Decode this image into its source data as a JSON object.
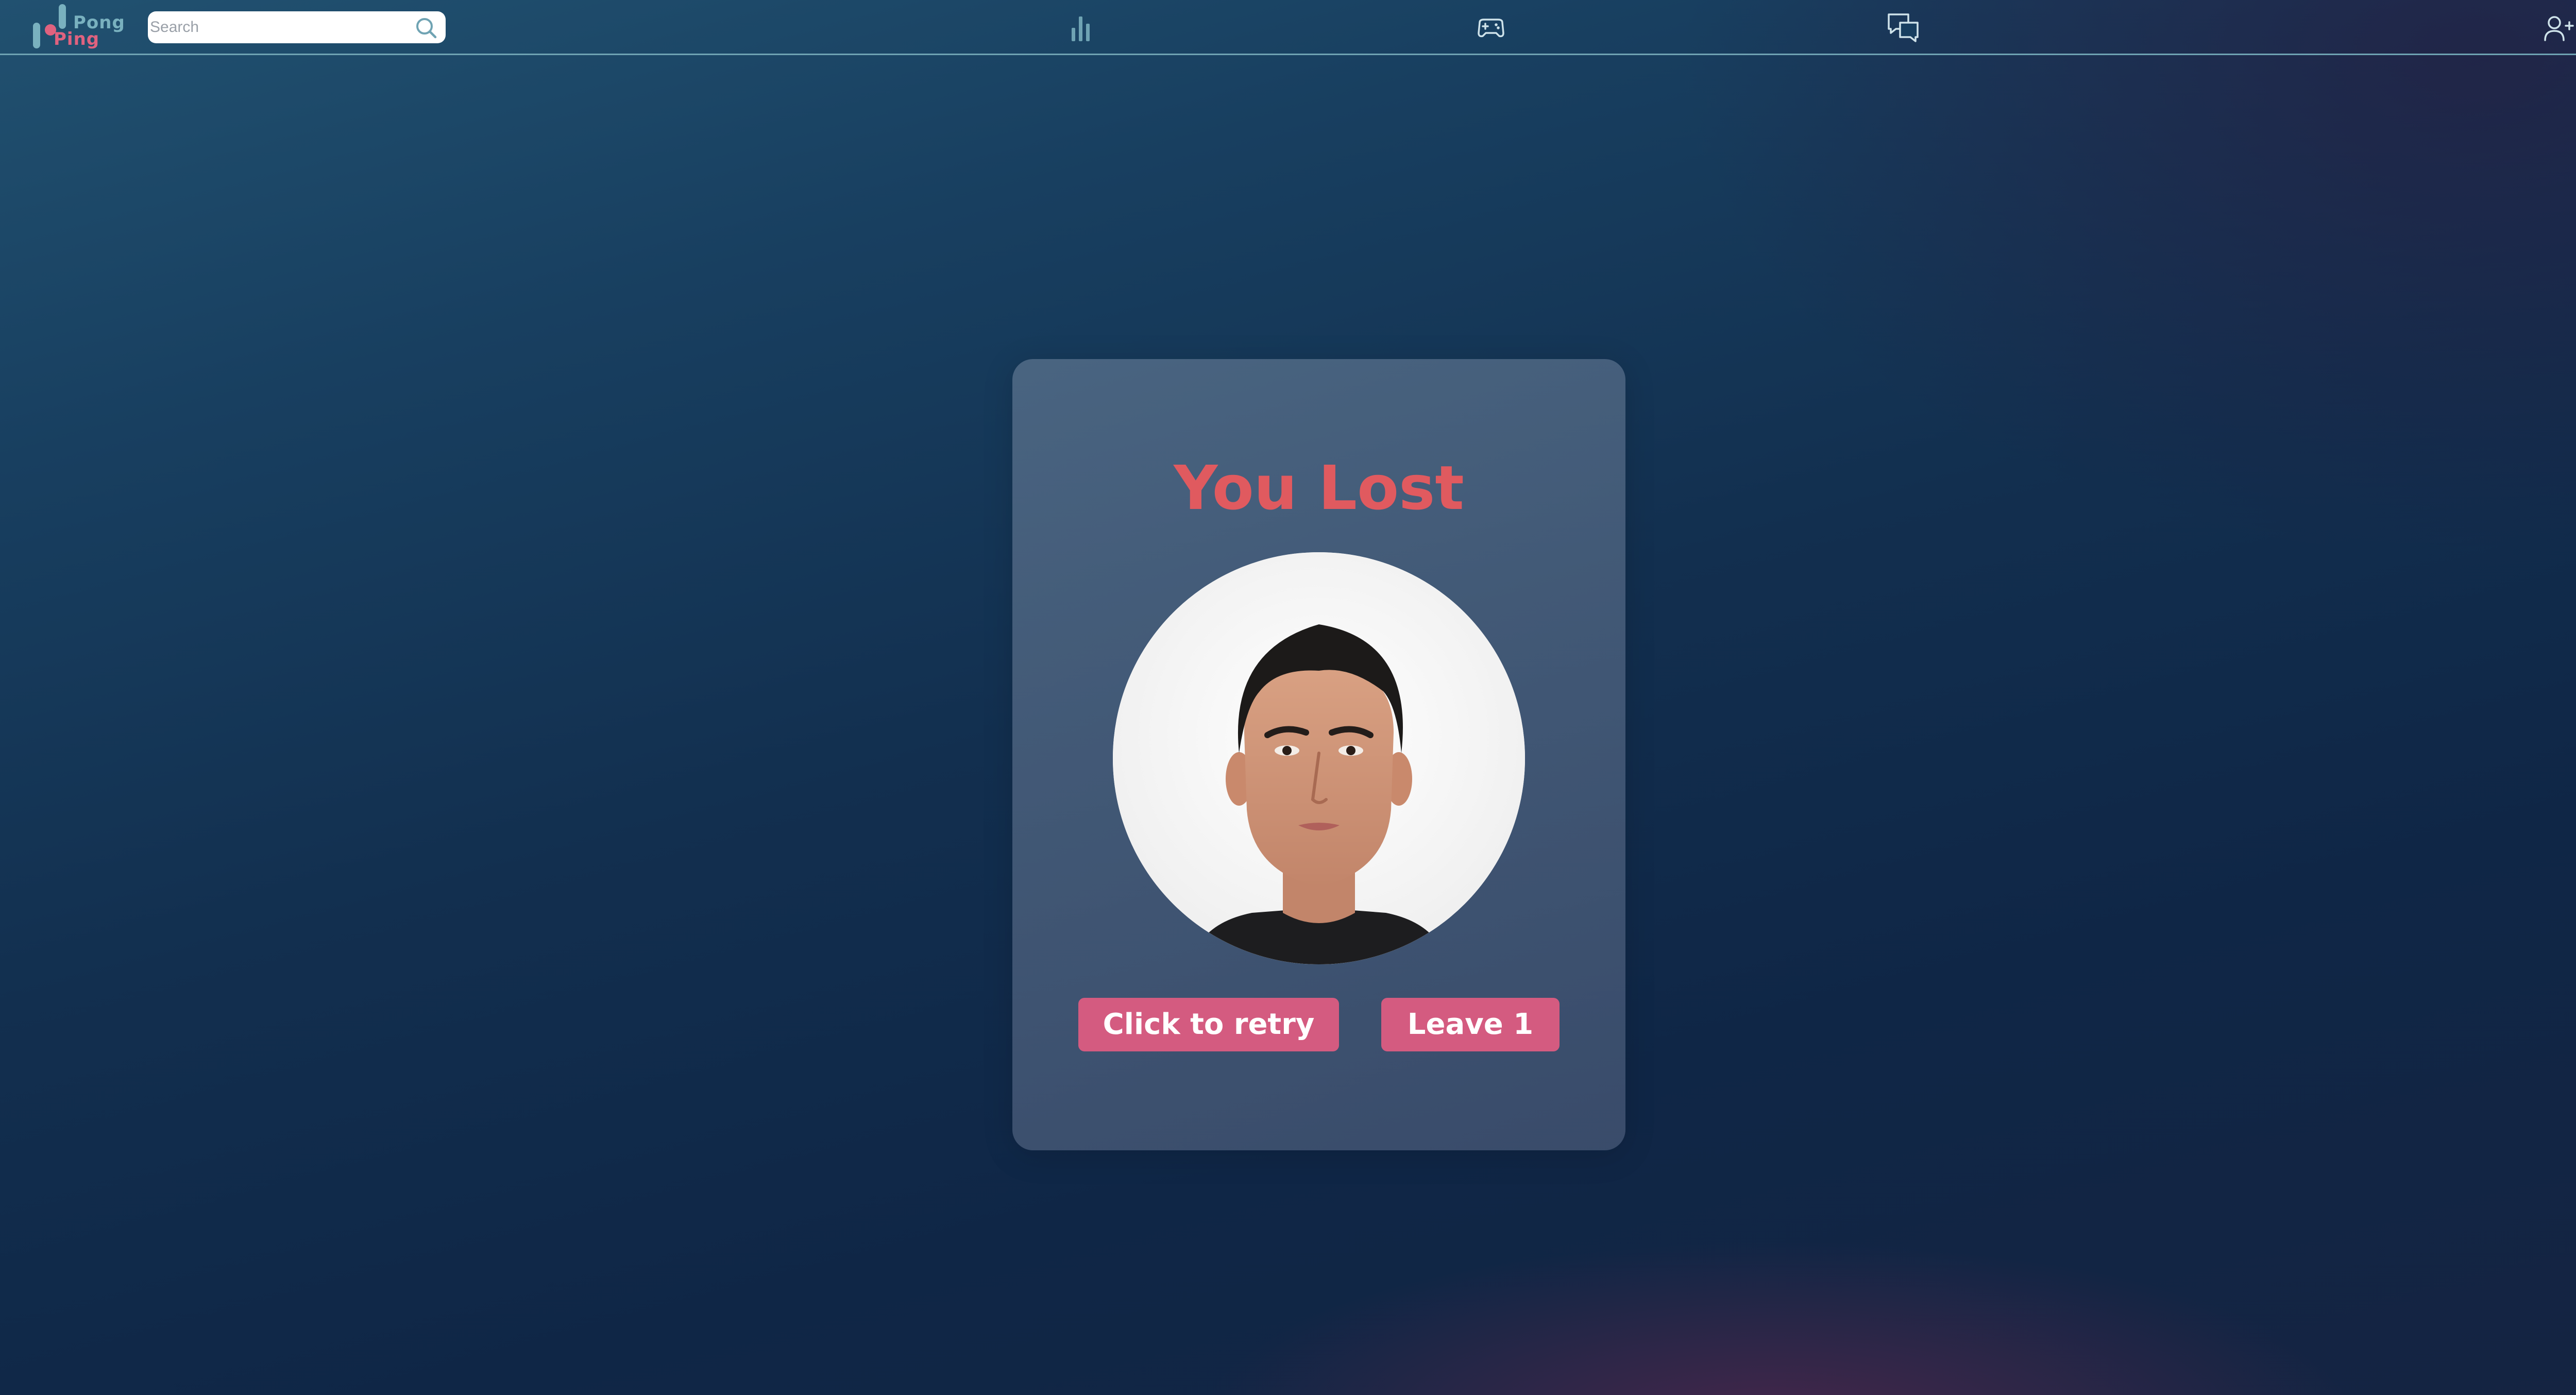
{
  "brand": {
    "name_top": "Pong",
    "name_bottom": "Ping",
    "accent_teal": "#79b1bf",
    "accent_pink": "#e0627f"
  },
  "search": {
    "placeholder": "Search",
    "value": "",
    "icon": "search-icon"
  },
  "nav": {
    "items": [
      {
        "icon": "bar-chart-icon"
      },
      {
        "icon": "gamepad-icon"
      },
      {
        "icon": "chat-icon"
      }
    ],
    "right": [
      {
        "icon": "add-user-icon"
      },
      {
        "icon": "avatar"
      }
    ]
  },
  "result": {
    "title": "You Lost",
    "title_color": "#e05a5f",
    "retry_label": "Click to retry",
    "leave_label": "Leave 1",
    "button_color": "#d45b80"
  }
}
